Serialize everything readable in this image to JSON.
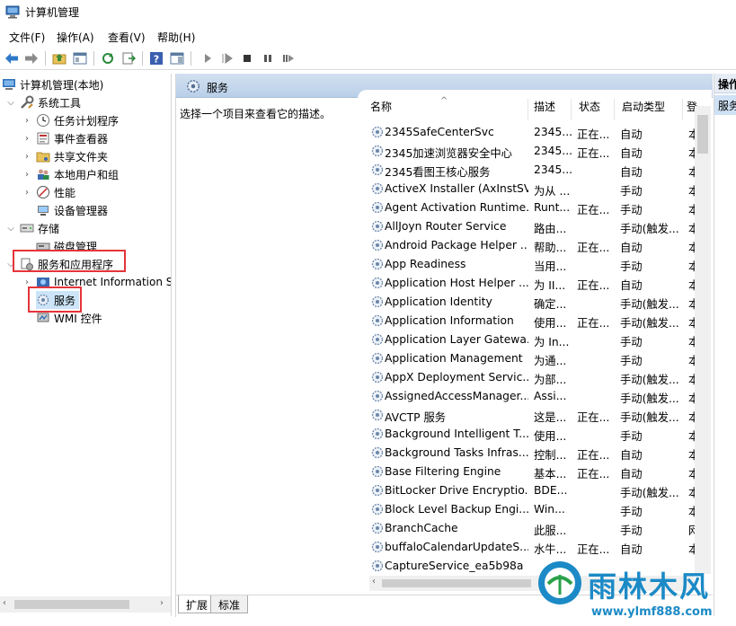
{
  "window": {
    "title": "计算机管理"
  },
  "menu": [
    "文件(F)",
    "操作(A)",
    "查看(V)",
    "帮助(H)"
  ],
  "tree": {
    "root": "计算机管理(本地)",
    "system_tools": "系统工具",
    "task_scheduler": "任务计划程序",
    "event_viewer": "事件查看器",
    "shared_folders": "共享文件夹",
    "local_users": "本地用户和组",
    "performance": "性能",
    "device_manager": "设备管理器",
    "storage": "存储",
    "disk_management": "磁盘管理",
    "services_apps": "服务和应用程序",
    "iis": "Internet Information S",
    "services": "服务",
    "wmi": "WMI 控件"
  },
  "center": {
    "header": "服务",
    "description_hint": "选择一个项目来查看它的描述。",
    "columns": [
      "名称",
      "描述",
      "状态",
      "启动类型",
      "登"
    ],
    "rows": [
      [
        "2345SafeCenterSvc",
        "2345...",
        "正在...",
        "自动",
        "本"
      ],
      [
        "2345加速浏览器安全中心",
        "2345...",
        "正在...",
        "自动",
        "本"
      ],
      [
        "2345看图王核心服务",
        "2345...",
        "",
        "自动",
        "本"
      ],
      [
        "ActiveX Installer (AxInstSV)",
        "为从 ...",
        "",
        "手动",
        "本"
      ],
      [
        "Agent Activation Runtime...",
        "Runt...",
        "正在...",
        "手动",
        "本"
      ],
      [
        "AllJoyn Router Service",
        "路由...",
        "",
        "手动(触发...",
        "本"
      ],
      [
        "Android Package Helper ...",
        "帮助...",
        "正在...",
        "自动",
        "本"
      ],
      [
        "App Readiness",
        "当用...",
        "",
        "手动",
        "本"
      ],
      [
        "Application Host Helper ...",
        "为 II...",
        "正在...",
        "自动",
        "本"
      ],
      [
        "Application Identity",
        "确定...",
        "",
        "手动(触发...",
        "本"
      ],
      [
        "Application Information",
        "使用...",
        "正在...",
        "手动(触发...",
        "本"
      ],
      [
        "Application Layer Gatewa...",
        "为 In...",
        "",
        "手动",
        "本"
      ],
      [
        "Application Management",
        "为通...",
        "",
        "手动",
        "本"
      ],
      [
        "AppX Deployment Servic...",
        "为部...",
        "",
        "手动(触发...",
        "本"
      ],
      [
        "AssignedAccessManager...",
        "Assi...",
        "",
        "手动(触发...",
        "本"
      ],
      [
        "AVCTP 服务",
        "这是...",
        "正在...",
        "手动(触发...",
        "本"
      ],
      [
        "Background Intelligent T...",
        "使用...",
        "",
        "手动",
        "本"
      ],
      [
        "Background Tasks Infras...",
        "控制...",
        "正在...",
        "自动",
        "本"
      ],
      [
        "Base Filtering Engine",
        "基本...",
        "正在...",
        "自动",
        "本"
      ],
      [
        "BitLocker Drive Encryptio...",
        "BDE...",
        "",
        "手动(触发...",
        "本"
      ],
      [
        "Block Level Backup Engi...",
        "Win...",
        "",
        "手动",
        "本"
      ],
      [
        "BranchCache",
        "此服...",
        "",
        "手动",
        "网"
      ],
      [
        "buffaloCalendarUpdateS...",
        "水牛...",
        "正在...",
        "自动",
        "本"
      ],
      [
        "CaptureService_ea5b98a",
        "",
        "",
        "",
        ""
      ]
    ],
    "tabs": [
      "扩展",
      "标准"
    ]
  },
  "actions": {
    "header": "操作",
    "item": "服务"
  },
  "watermark": {
    "brand": "雨林木风",
    "url": "www.ylmf888.com"
  },
  "colors": {
    "highlight": "#e5343a",
    "header_blue": "#b9cfe8",
    "watermark": "#1b8ac6"
  }
}
